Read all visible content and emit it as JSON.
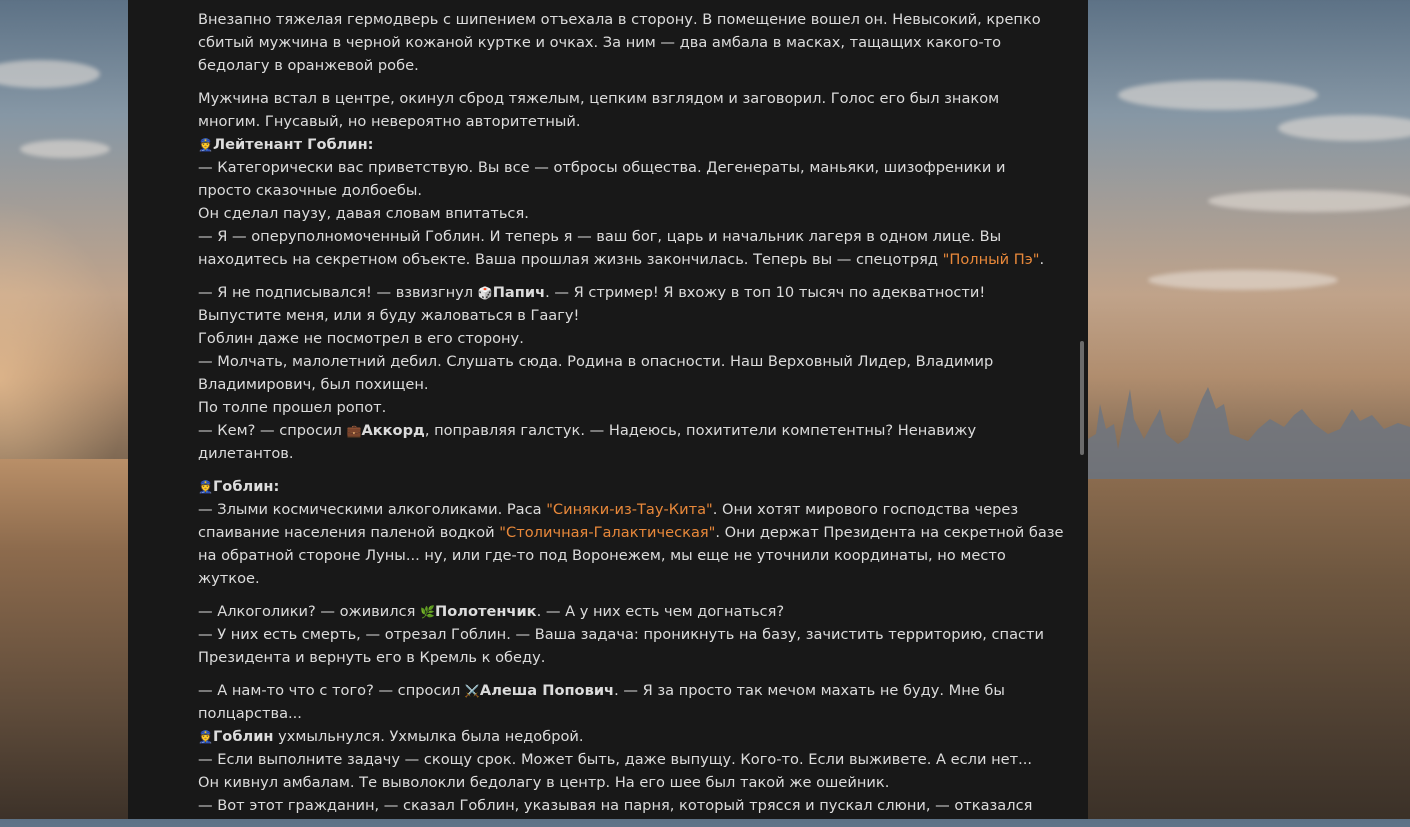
{
  "story": {
    "p1": [
      "Внезапно тяжелая гермодверь с шипением отъехала в сторону. В помещение вошел он. Невысокий, крепко",
      "сбитый мужчина в черной кожаной куртке и очках. За ним — два амбала в масках, тащащих какого-то",
      "бедолагу в оранжевой робе."
    ],
    "p2": {
      "l1": "Мужчина встал в центре, окинул сброд тяжелым, цепким взглядом и заговорил. Голос его был знаком",
      "l2": "многим. Гнусавый, но невероятно авторитетный.",
      "speaker_emoji": "👮",
      "speaker": "Лейтенант Гоблин:",
      "l3": "— Категорически вас приветствую. Вы все — отбросы общества. Дегенераты, маньяки, шизофреники и",
      "l4": "просто сказочные долбоебы.",
      "l5": "Он сделал паузу, давая словам впитаться.",
      "l6": "— Я — оперуполномоченный Гоблин. И теперь я — ваш бог, царь и начальник лагеря в одном лице. Вы",
      "l7a": "находитесь на секретном объекте. Ваша прошлая жизнь закончилась. Теперь вы — спецотряд ",
      "l7_hl": "\"Полный Пэ\"",
      "l7b": "."
    },
    "p3": {
      "l1a": "— Я не подписывался! — взвизгнул ",
      "l1_emoji": "🎲",
      "l1_name": "Папич",
      "l1b": ". — Я стример! Я вхожу в топ 10 тысяч по адекватности!",
      "l2": "Выпустите меня, или я буду жаловаться в Гаагу!",
      "l3": "Гоблин даже не посмотрел в его сторону.",
      "l4": "— Молчать, малолетний дебил. Слушать сюда. Родина в опасности. Наш Верховный Лидер, Владимир",
      "l5": "Владимирович, был похищен.",
      "l6": "По толпе прошел ропот.",
      "l7a": "— Кем? — спросил ",
      "l7_emoji": "💼",
      "l7_name": "Аккорд",
      "l7b": ", поправляя галстук. — Надеюсь, похитители компетентны? Ненавижу",
      "l8": "дилетантов."
    },
    "p4": {
      "speaker_emoji": "👮",
      "speaker": "Гоблин:",
      "l1a": "— Злыми космическими алкоголиками. Раса ",
      "l1_hl": "\"Синяки-из-Тау-Кита\"",
      "l1b": ". Они хотят мирового господства через",
      "l2a": "спаивание населения паленой водкой ",
      "l2_hl": "\"Столичная-Галактическая\"",
      "l2b": ". Они держат Президента на секретной базе",
      "l3": "на обратной стороне Луны... ну, или где-то под Воронежем, мы еще не уточнили координаты, но место",
      "l4": "жуткое."
    },
    "p5": {
      "l1a": "— Алкоголики? — оживился ",
      "l1_emoji": "🌿",
      "l1_name": "Полотенчик",
      "l1b": ". — А у них есть чем догнаться?",
      "l2": "— У них есть смерть, — отрезал Гоблин. — Ваша задача: проникнуть на базу, зачистить территорию, спасти",
      "l3": "Президента и вернуть его в Кремль к обеду."
    },
    "p6": {
      "l1a": "— А нам-то что с того? — спросил ",
      "l1_emoji": "⚔️",
      "l1_name": "Алеша Попович",
      "l1b": ". — Я за просто так мечом махать не буду. Мне бы",
      "l2": "полцарства...",
      "l3_emoji": "👮",
      "l3_name": "Гоблин",
      "l3b": " ухмыльнулся. Ухмылка была недоброй.",
      "l4": "— Если выполните задачу — скощу срок. Может быть, даже выпущу. Кого-то. Если выживете. А если нет...",
      "l5": "Он кивнул амбалам. Те выволокли бедолагу в центр. На его шее был такой же ошейник.",
      "l6": "— Вот этот гражданин, — сказал Гоблин, указывая на парня, который трясся и пускал слюни, — отказался"
    }
  },
  "colors": {
    "panel_bg": "#181818",
    "text": "#dcdcdc",
    "highlight": "#e8883a"
  }
}
